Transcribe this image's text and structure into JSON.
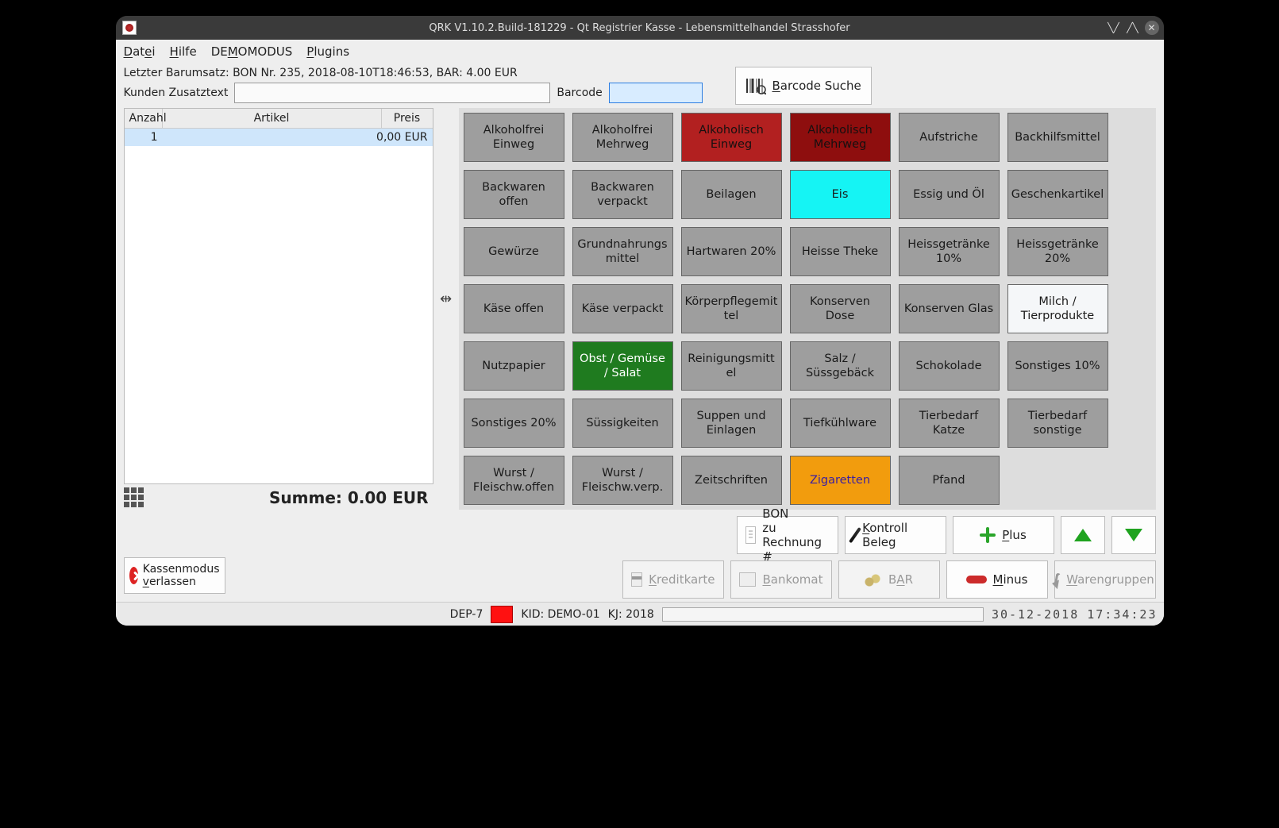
{
  "window": {
    "title": "QRK V1.10.2.Build-181229 - Qt Registrier Kasse - Lebensmittelhandel Strasshofer"
  },
  "menu": {
    "file": "Datei",
    "help": "Hilfe",
    "demo": "DEMOMODUS",
    "plugins": "Plugins"
  },
  "last_turnover": "Letzter Barumsatz: BON Nr. 235, 2018-08-10T18:46:53, BAR: 4.00 EUR",
  "customer_extra_label": "Kunden Zusatztext",
  "customer_extra_value": "",
  "barcode_label": "Barcode",
  "barcode_value": "",
  "barcode_search": "Barcode Suche",
  "table": {
    "headers": {
      "qty": "Anzahl",
      "article": "Artikel",
      "price": "Preis"
    },
    "rows": [
      {
        "qty": "1",
        "article": "",
        "price": "0,00 EUR",
        "selected": true
      }
    ]
  },
  "sum_label": "Summe: 0.00 EUR",
  "categories": [
    {
      "label": "Alkoholfrei Einweg",
      "style": ""
    },
    {
      "label": "Alkoholfrei Mehrweg",
      "style": ""
    },
    {
      "label": "Alkoholisch Einweg",
      "style": "red"
    },
    {
      "label": "Alkoholisch Mehrweg",
      "style": "darkred"
    },
    {
      "label": "Aufstriche",
      "style": ""
    },
    {
      "label": "Backhilfsmittel",
      "style": ""
    },
    {
      "label": "Backwaren offen",
      "style": ""
    },
    {
      "label": "Backwaren verpackt",
      "style": ""
    },
    {
      "label": "Beilagen",
      "style": ""
    },
    {
      "label": "Eis",
      "style": "cyan"
    },
    {
      "label": "Essig und Öl",
      "style": ""
    },
    {
      "label": "Geschenkartikel",
      "style": ""
    },
    {
      "label": "Gewürze",
      "style": ""
    },
    {
      "label": "Grundnahrungsmittel",
      "style": ""
    },
    {
      "label": "Hartwaren 20%",
      "style": ""
    },
    {
      "label": "Heisse Theke",
      "style": ""
    },
    {
      "label": "Heissgetränke 10%",
      "style": ""
    },
    {
      "label": "Heissgetränke 20%",
      "style": ""
    },
    {
      "label": "Käse offen",
      "style": ""
    },
    {
      "label": "Käse verpackt",
      "style": ""
    },
    {
      "label": "Körperpflegemittel",
      "style": ""
    },
    {
      "label": "Konserven Dose",
      "style": ""
    },
    {
      "label": "Konserven Glas",
      "style": ""
    },
    {
      "label": "Milch / Tierprodukte",
      "style": "white"
    },
    {
      "label": "Nutzpapier",
      "style": ""
    },
    {
      "label": "Obst / Gemüse / Salat",
      "style": "green"
    },
    {
      "label": "Reinigungsmittel",
      "style": ""
    },
    {
      "label": "Salz / Süssgebäck",
      "style": ""
    },
    {
      "label": "Schokolade",
      "style": ""
    },
    {
      "label": "Sonstiges 10%",
      "style": ""
    },
    {
      "label": "Sonstiges 20%",
      "style": ""
    },
    {
      "label": "Süssigkeiten",
      "style": ""
    },
    {
      "label": "Suppen und Einlagen",
      "style": ""
    },
    {
      "label": "Tiefkühlware",
      "style": ""
    },
    {
      "label": "Tierbedarf Katze",
      "style": ""
    },
    {
      "label": "Tierbedarf sonstige",
      "style": ""
    },
    {
      "label": "Wurst / Fleischw.offen",
      "style": ""
    },
    {
      "label": "Wurst / Fleischw.verp.",
      "style": ""
    },
    {
      "label": "Zeitschriften",
      "style": ""
    },
    {
      "label": "Zigaretten",
      "style": "orange"
    },
    {
      "label": "Pfand",
      "style": ""
    }
  ],
  "buttons": {
    "bon_to_invoice": "BON\nzu Rechnung #",
    "kontroll_beleg": "Kontroll Beleg",
    "plus": "Plus",
    "kreditkarte": "Kreditkarte",
    "bankomat": "Bankomat",
    "bar": "BAR",
    "minus": "Minus",
    "warengruppen": "Warengruppen",
    "exit": "Kassenmodus\nverlassen"
  },
  "status": {
    "dep": "DEP-7",
    "kid": "KID: DEMO-01",
    "kj": "KJ: 2018",
    "date": "30-12-2018",
    "time": "17:34:23"
  }
}
